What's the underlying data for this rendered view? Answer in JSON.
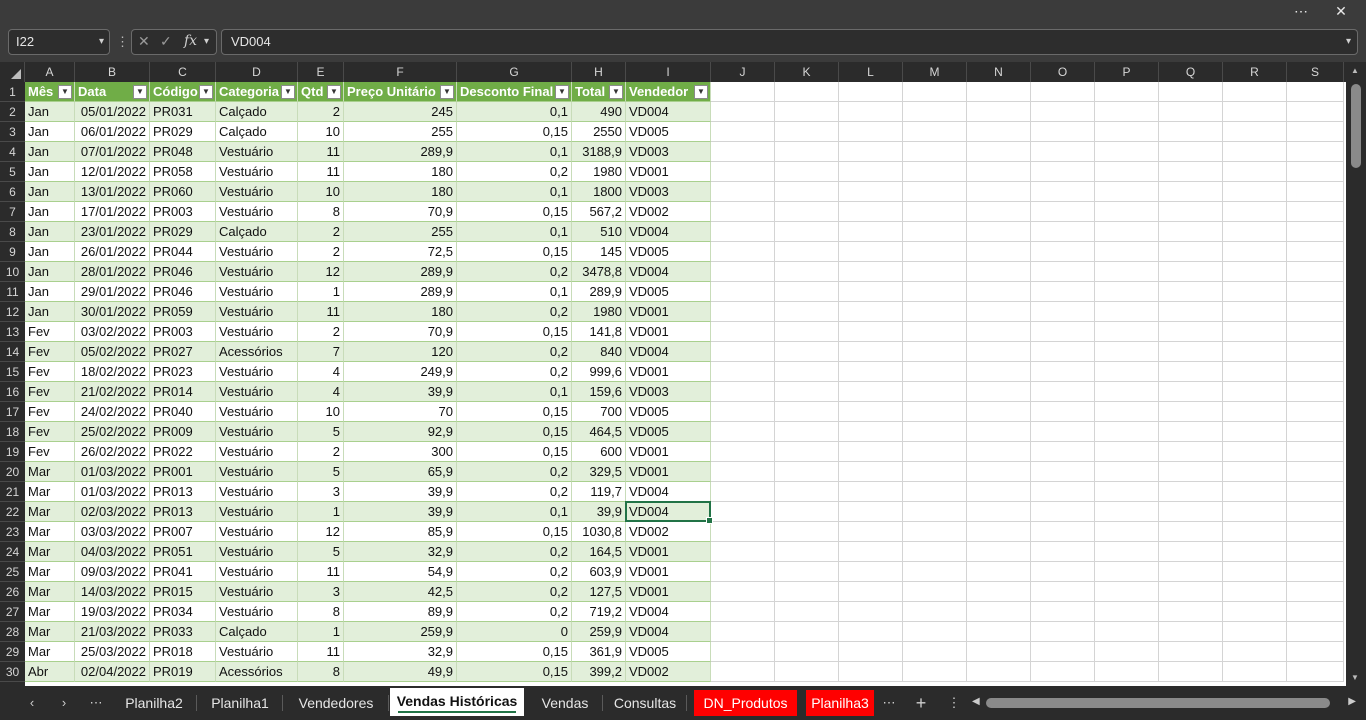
{
  "window": {
    "more_icon": "⋯",
    "close_icon": "✕"
  },
  "formula_bar": {
    "name_box": "I22",
    "dropdown_icon": "▾",
    "more_icon": "⋮",
    "cancel_icon": "✕",
    "confirm_icon": "✓",
    "fx_icon": "fx",
    "formula": "VD004"
  },
  "columns": [
    "A",
    "B",
    "C",
    "D",
    "E",
    "F",
    "G",
    "H",
    "I",
    "J",
    "K",
    "L",
    "M",
    "N",
    "O",
    "P",
    "Q",
    "R",
    "S"
  ],
  "rows": [
    "1",
    "2",
    "3",
    "4",
    "5",
    "6",
    "7",
    "8",
    "9",
    "10",
    "11",
    "12",
    "13",
    "14",
    "15",
    "16",
    "17",
    "18",
    "19",
    "20",
    "21",
    "22",
    "23",
    "24",
    "25",
    "26",
    "27",
    "28",
    "29",
    "30"
  ],
  "table": {
    "headers": [
      "Mês",
      "Data",
      "Código",
      "Categoria",
      "Qtd",
      "Preço Unitário",
      "Desconto Final",
      "Total",
      "Vendedor"
    ],
    "filter_icon": "▼",
    "records": [
      [
        "Jan",
        "05/01/2022",
        "PR031",
        "Calçado",
        "2",
        "245",
        "0,1",
        "490",
        "VD004"
      ],
      [
        "Jan",
        "06/01/2022",
        "PR029",
        "Calçado",
        "10",
        "255",
        "0,15",
        "2550",
        "VD005"
      ],
      [
        "Jan",
        "07/01/2022",
        "PR048",
        "Vestuário",
        "11",
        "289,9",
        "0,1",
        "3188,9",
        "VD003"
      ],
      [
        "Jan",
        "12/01/2022",
        "PR058",
        "Vestuário",
        "11",
        "180",
        "0,2",
        "1980",
        "VD001"
      ],
      [
        "Jan",
        "13/01/2022",
        "PR060",
        "Vestuário",
        "10",
        "180",
        "0,1",
        "1800",
        "VD003"
      ],
      [
        "Jan",
        "17/01/2022",
        "PR003",
        "Vestuário",
        "8",
        "70,9",
        "0,15",
        "567,2",
        "VD002"
      ],
      [
        "Jan",
        "23/01/2022",
        "PR029",
        "Calçado",
        "2",
        "255",
        "0,1",
        "510",
        "VD004"
      ],
      [
        "Jan",
        "26/01/2022",
        "PR044",
        "Vestuário",
        "2",
        "72,5",
        "0,15",
        "145",
        "VD005"
      ],
      [
        "Jan",
        "28/01/2022",
        "PR046",
        "Vestuário",
        "12",
        "289,9",
        "0,2",
        "3478,8",
        "VD004"
      ],
      [
        "Jan",
        "29/01/2022",
        "PR046",
        "Vestuário",
        "1",
        "289,9",
        "0,1",
        "289,9",
        "VD005"
      ],
      [
        "Jan",
        "30/01/2022",
        "PR059",
        "Vestuário",
        "11",
        "180",
        "0,2",
        "1980",
        "VD001"
      ],
      [
        "Fev",
        "03/02/2022",
        "PR003",
        "Vestuário",
        "2",
        "70,9",
        "0,15",
        "141,8",
        "VD001"
      ],
      [
        "Fev",
        "05/02/2022",
        "PR027",
        "Acessórios",
        "7",
        "120",
        "0,2",
        "840",
        "VD004"
      ],
      [
        "Fev",
        "18/02/2022",
        "PR023",
        "Vestuário",
        "4",
        "249,9",
        "0,2",
        "999,6",
        "VD001"
      ],
      [
        "Fev",
        "21/02/2022",
        "PR014",
        "Vestuário",
        "4",
        "39,9",
        "0,1",
        "159,6",
        "VD003"
      ],
      [
        "Fev",
        "24/02/2022",
        "PR040",
        "Vestuário",
        "10",
        "70",
        "0,15",
        "700",
        "VD005"
      ],
      [
        "Fev",
        "25/02/2022",
        "PR009",
        "Vestuário",
        "5",
        "92,9",
        "0,15",
        "464,5",
        "VD005"
      ],
      [
        "Fev",
        "26/02/2022",
        "PR022",
        "Vestuário",
        "2",
        "300",
        "0,15",
        "600",
        "VD001"
      ],
      [
        "Mar",
        "01/03/2022",
        "PR001",
        "Vestuário",
        "5",
        "65,9",
        "0,2",
        "329,5",
        "VD001"
      ],
      [
        "Mar",
        "01/03/2022",
        "PR013",
        "Vestuário",
        "3",
        "39,9",
        "0,2",
        "119,7",
        "VD004"
      ],
      [
        "Mar",
        "02/03/2022",
        "PR013",
        "Vestuário",
        "1",
        "39,9",
        "0,1",
        "39,9",
        "VD004"
      ],
      [
        "Mar",
        "03/03/2022",
        "PR007",
        "Vestuário",
        "12",
        "85,9",
        "0,15",
        "1030,8",
        "VD002"
      ],
      [
        "Mar",
        "04/03/2022",
        "PR051",
        "Vestuário",
        "5",
        "32,9",
        "0,2",
        "164,5",
        "VD001"
      ],
      [
        "Mar",
        "09/03/2022",
        "PR041",
        "Vestuário",
        "11",
        "54,9",
        "0,2",
        "603,9",
        "VD001"
      ],
      [
        "Mar",
        "14/03/2022",
        "PR015",
        "Vestuário",
        "3",
        "42,5",
        "0,2",
        "127,5",
        "VD001"
      ],
      [
        "Mar",
        "19/03/2022",
        "PR034",
        "Vestuário",
        "8",
        "89,9",
        "0,2",
        "719,2",
        "VD004"
      ],
      [
        "Mar",
        "21/03/2022",
        "PR033",
        "Calçado",
        "1",
        "259,9",
        "0",
        "259,9",
        "VD004"
      ],
      [
        "Mar",
        "25/03/2022",
        "PR018",
        "Vestuário",
        "11",
        "32,9",
        "0,15",
        "361,9",
        "VD005"
      ],
      [
        "Abr",
        "02/04/2022",
        "PR019",
        "Acessórios",
        "8",
        "49,9",
        "0,15",
        "399,2",
        "VD002"
      ]
    ]
  },
  "selected_cell": {
    "column": "I",
    "row": "22"
  },
  "sheet_tabs": {
    "prev_icon": "‹",
    "next_icon": "›",
    "more_icon": "⋯",
    "add_icon": "+",
    "options_icon": "⋮",
    "tabs": [
      {
        "label": "Planilha2",
        "active": false,
        "color": ""
      },
      {
        "label": "Planilha1",
        "active": false,
        "color": ""
      },
      {
        "label": "Vendedores",
        "active": false,
        "color": ""
      },
      {
        "label": "Vendas Históricas",
        "active": true,
        "color": ""
      },
      {
        "label": "Vendas",
        "active": false,
        "color": ""
      },
      {
        "label": "Consultas",
        "active": false,
        "color": ""
      },
      {
        "label": "DN_Produtos",
        "active": false,
        "color": "#ff0000"
      },
      {
        "label": "Planilha3",
        "active": false,
        "color": "#ff0000"
      }
    ]
  },
  "colors": {
    "table_header": "#70ad47",
    "table_band": "#e2efda",
    "selection": "#217346",
    "chrome": "#2b2b2b"
  }
}
